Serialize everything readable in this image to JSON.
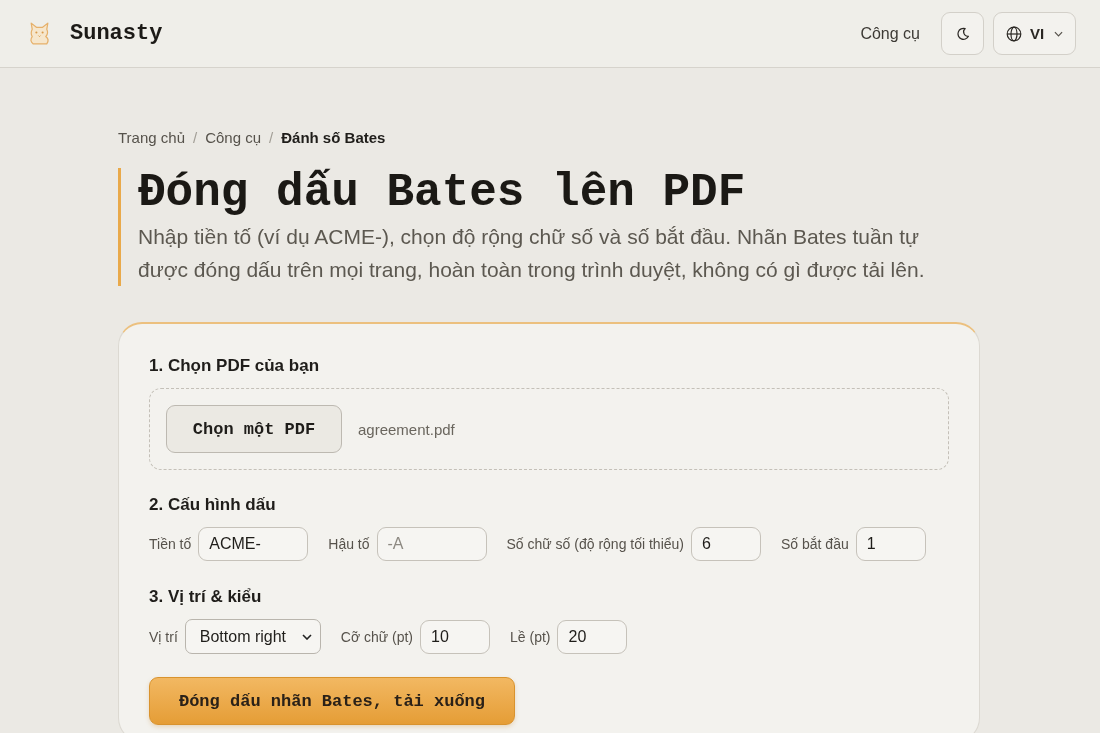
{
  "header": {
    "brand": "Sunasty",
    "nav_link": "Công cụ",
    "language": "VI"
  },
  "breadcrumbs": [
    {
      "label": "Trang chủ",
      "current": false,
      "separator": "/"
    },
    {
      "label": "Công cụ",
      "current": false,
      "separator": "/"
    },
    {
      "label": "Đánh số Bates",
      "current": true
    }
  ],
  "title": "Đóng dấu Bates lên PDF",
  "subtitle": "Nhập tiền tố (ví dụ ACME-), chọn độ rộng chữ số và số bắt đầu. Nhãn Bates tuần tự được đóng dấu trên mọi trang, hoàn toàn trong trình duyệt, không có gì được tải lên.",
  "sections": [
    {
      "heading": "1. Chọn PDF của bạn",
      "kind": "file",
      "button": "Chọn một PDF",
      "file_name": "agreement.pdf"
    },
    {
      "heading": "2. Cấu hình dấu",
      "kind": "fields",
      "fields": [
        {
          "label": "Tiền tố",
          "kind": "text",
          "value": "ACME-"
        },
        {
          "label": "Hậu tố",
          "kind": "text",
          "placeholder": "-A"
        },
        {
          "label": "Số chữ số (độ rộng tối thiểu)",
          "kind": "number",
          "value": "6"
        },
        {
          "label": "Số bắt đầu",
          "kind": "number",
          "value": "1"
        }
      ]
    },
    {
      "heading": "3. Vị trí & kiểu",
      "kind": "fields",
      "fields": [
        {
          "label": "Vị trí",
          "kind": "select",
          "value": "Bottom right"
        },
        {
          "label": "Cỡ chữ (pt)",
          "kind": "number",
          "value": "10"
        },
        {
          "label": "Lề (pt)",
          "kind": "number",
          "value": "20"
        }
      ]
    }
  ],
  "submit_button": "Đóng dấu nhãn Bates, tải xuống"
}
